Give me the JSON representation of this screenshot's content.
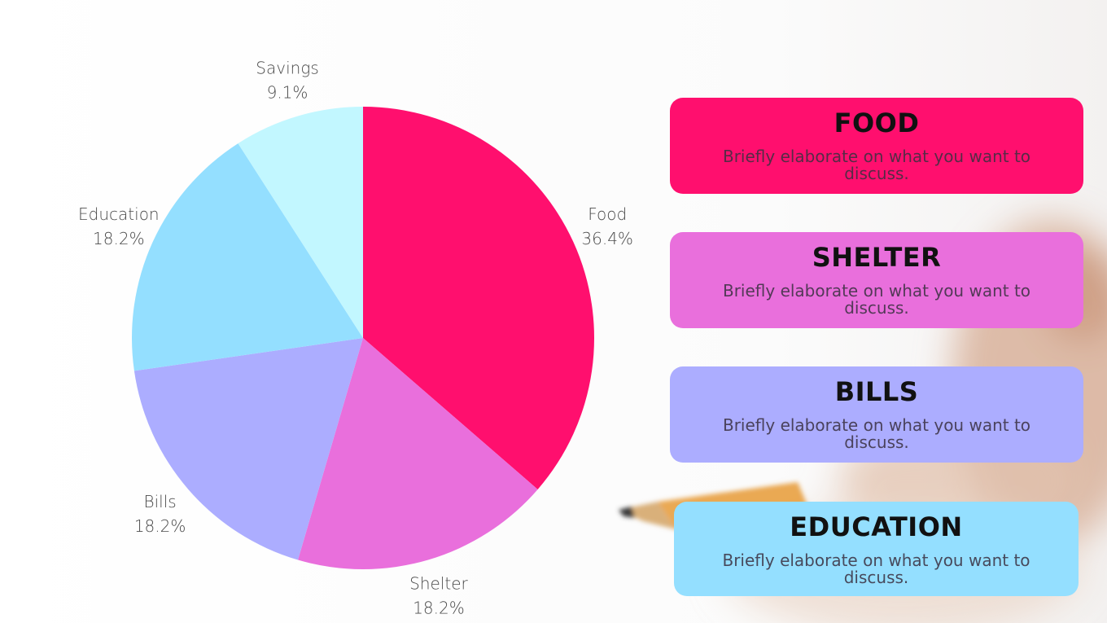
{
  "colors": {
    "food": "#FF0F6E",
    "shelter": "#E96FDC",
    "bills": "#ACADFF",
    "education": "#94DFFF",
    "savings": "#C2F7FF"
  },
  "chart_data": {
    "type": "pie",
    "title": "",
    "slices": [
      {
        "label": "Food",
        "value": 36.4,
        "value_label": "36.4%",
        "color": "#FF0F6E"
      },
      {
        "label": "Shelter",
        "value": 18.2,
        "value_label": "18.2%",
        "color": "#E96FDC"
      },
      {
        "label": "Bills",
        "value": 18.2,
        "value_label": "18.2%",
        "color": "#ACADFF"
      },
      {
        "label": "Education",
        "value": 18.2,
        "value_label": "18.2%",
        "color": "#94DFFF"
      },
      {
        "label": "Savings",
        "value": 9.1,
        "value_label": "9.1%",
        "color": "#C2F7FF"
      }
    ]
  },
  "cards": [
    {
      "title": "FOOD",
      "description": "Briefly elaborate on what you want to discuss.",
      "color": "#FF0F6E"
    },
    {
      "title": "SHELTER",
      "description": "Briefly elaborate on what you want to discuss.",
      "color": "#E96FDC"
    },
    {
      "title": "BILLS",
      "description": "Briefly elaborate on what you want to discuss.",
      "color": "#ACADFF"
    },
    {
      "title": "EDUCATION",
      "description": "Briefly elaborate on what you want to discuss.",
      "color": "#94DFFF"
    }
  ]
}
